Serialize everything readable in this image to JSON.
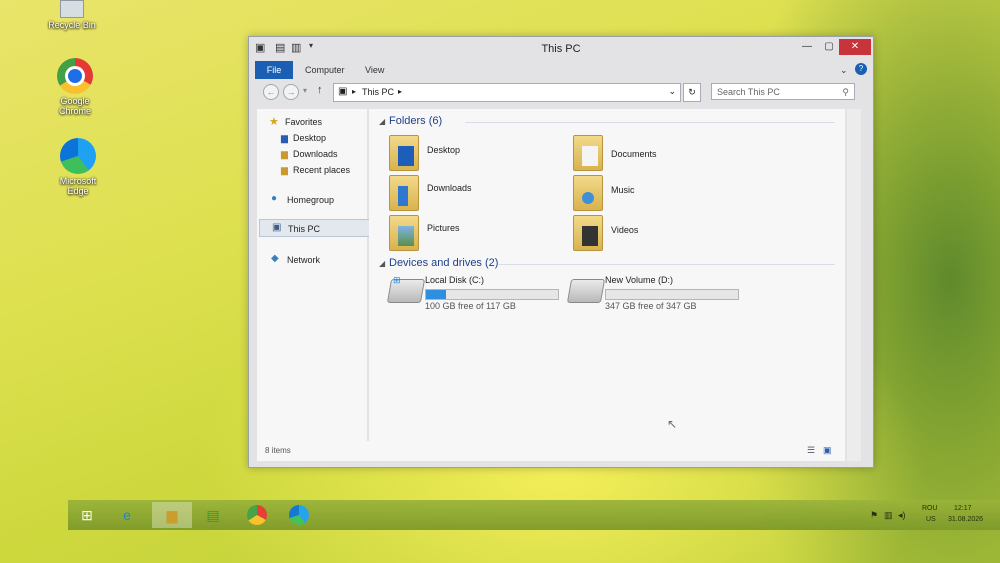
{
  "desktop": {
    "icons": [
      {
        "label": "Recycle Bin"
      },
      {
        "label": "Google Chrome"
      },
      {
        "label": "Microsoft Edge"
      }
    ]
  },
  "window": {
    "title": "This PC",
    "ribbon_tabs": [
      "File",
      "Computer",
      "View"
    ],
    "address_location": "This PC",
    "search_placeholder": "Search This PC",
    "nav": {
      "favorites": "Favorites",
      "favorites_items": [
        "Desktop",
        "Downloads",
        "Recent places"
      ],
      "homegroup": "Homegroup",
      "this_pc": "This PC",
      "network": "Network"
    },
    "folders_header": "Folders (6)",
    "folders": [
      "Desktop",
      "Documents",
      "Downloads",
      "Music",
      "Pictures",
      "Videos"
    ],
    "drives_header": "Devices and drives (2)",
    "drives": [
      {
        "name": "Local Disk (C:)",
        "free_text": "100 GB free of 117 GB",
        "used_fraction": 0.15
      },
      {
        "name": "New Volume (D:)",
        "free_text": "347 GB free of 347 GB",
        "used_fraction": 0.0
      }
    ],
    "status_text": "8 items"
  },
  "taskbar": {
    "apps": [
      "start",
      "internet-explorer",
      "file-explorer",
      "store",
      "chrome",
      "edge"
    ],
    "tray": {
      "language": "ROU",
      "region": "US",
      "time": "12:17",
      "date": "31.08.2026"
    }
  }
}
